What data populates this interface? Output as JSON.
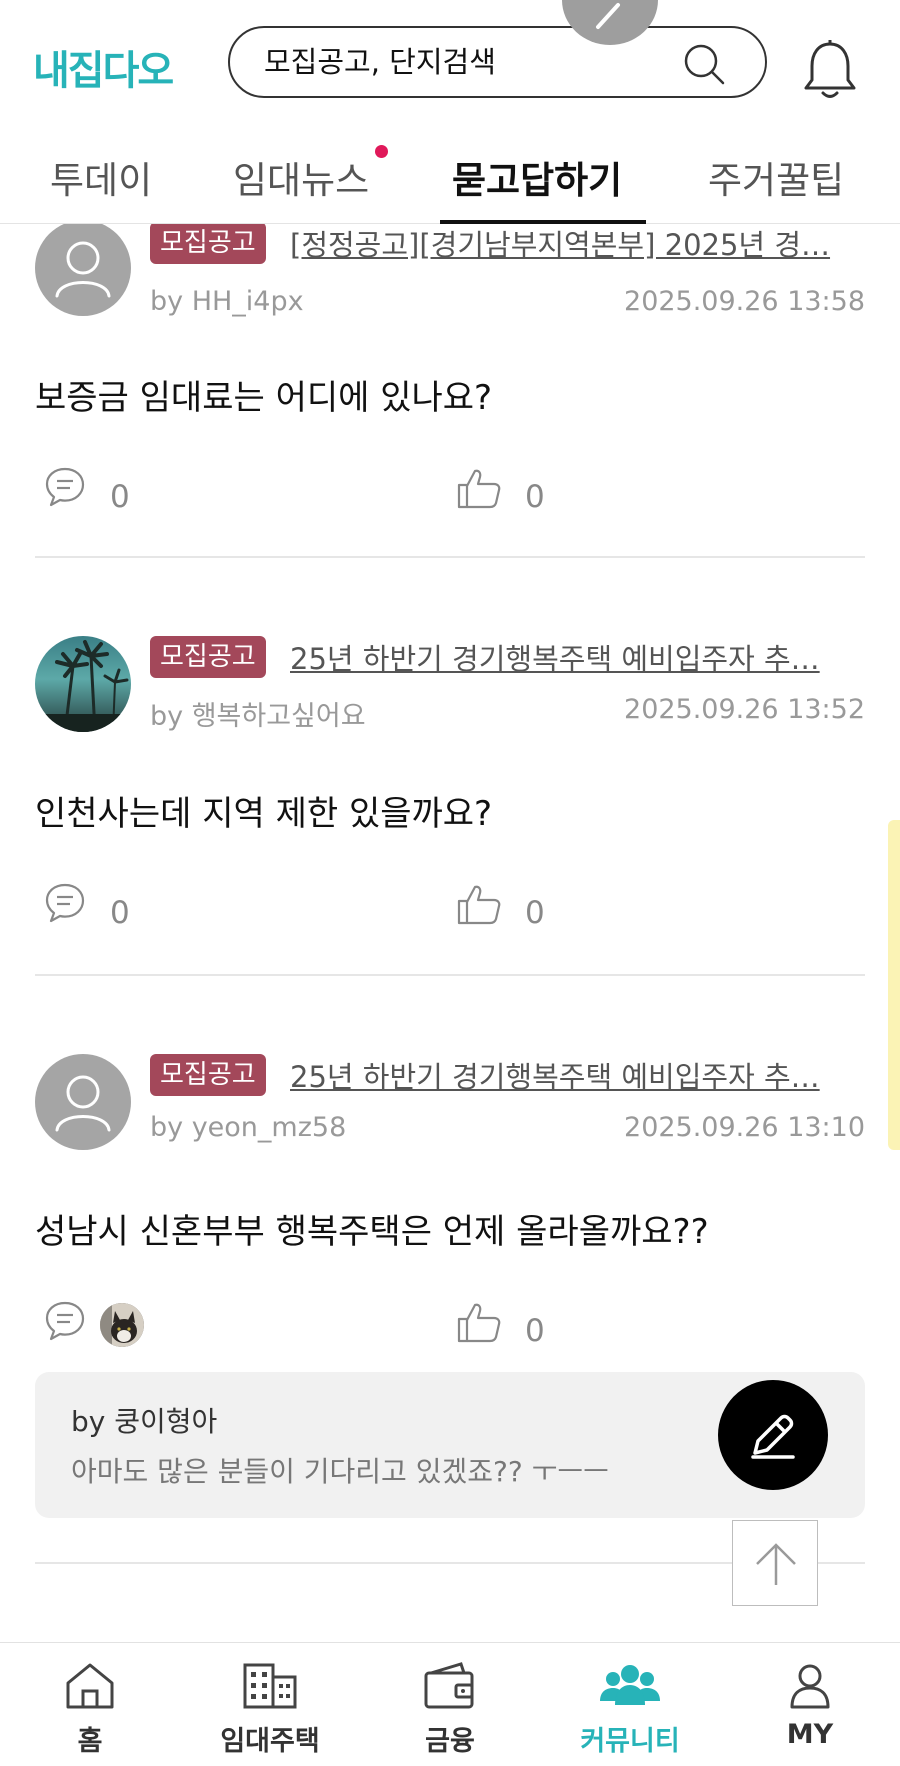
{
  "header": {
    "logo": "내집다오",
    "search_placeholder": "모집공고, 단지검색"
  },
  "tabs": [
    {
      "label": "투데이",
      "active": false
    },
    {
      "label": "임대뉴스",
      "active": false,
      "has_dot": true
    },
    {
      "label": "묻고답하기",
      "active": true
    },
    {
      "label": "주거꿀팁",
      "active": false
    }
  ],
  "posts": [
    {
      "badge": "모집공고",
      "link": "[정정공고][경기남부지역본부] 2025년 경…",
      "author": "by HH_i4px",
      "date": "2025.09.26 13:58",
      "question": "보증금 임대료는 어디에 있나요?",
      "comments": "0",
      "likes": "0"
    },
    {
      "badge": "모집공고",
      "link": "25년 하반기 경기행복주택 예비입주자 추…",
      "author": "by 행복하고싶어요",
      "date": "2025.09.26 13:52",
      "question": "인천사는데 지역 제한 있을까요?",
      "comments": "0",
      "likes": "0"
    },
    {
      "badge": "모집공고",
      "link": "25년 하반기 경기행복주택 예비입주자 추…",
      "author": "by yeon_mz58",
      "date": "2025.09.26 13:10",
      "question": "성남시 신혼부부 행복주택은 언제 올라올까요??",
      "likes": "0",
      "reply": {
        "author": "by 쿵이형아",
        "text": "아마도 많은 분들이 기다리고 있겠죠?? ㅜㅡㅡ"
      }
    }
  ],
  "bottom_nav": [
    {
      "label": "홈",
      "icon": "home-icon"
    },
    {
      "label": "임대주택",
      "icon": "building-icon"
    },
    {
      "label": "금융",
      "icon": "wallet-icon"
    },
    {
      "label": "커뮤니티",
      "icon": "community-icon",
      "active": true
    },
    {
      "label": "MY",
      "icon": "person-icon"
    }
  ],
  "colors": {
    "brand": "#27b3b8",
    "badge": "#a3485a",
    "notification_dot": "#e0195a"
  }
}
